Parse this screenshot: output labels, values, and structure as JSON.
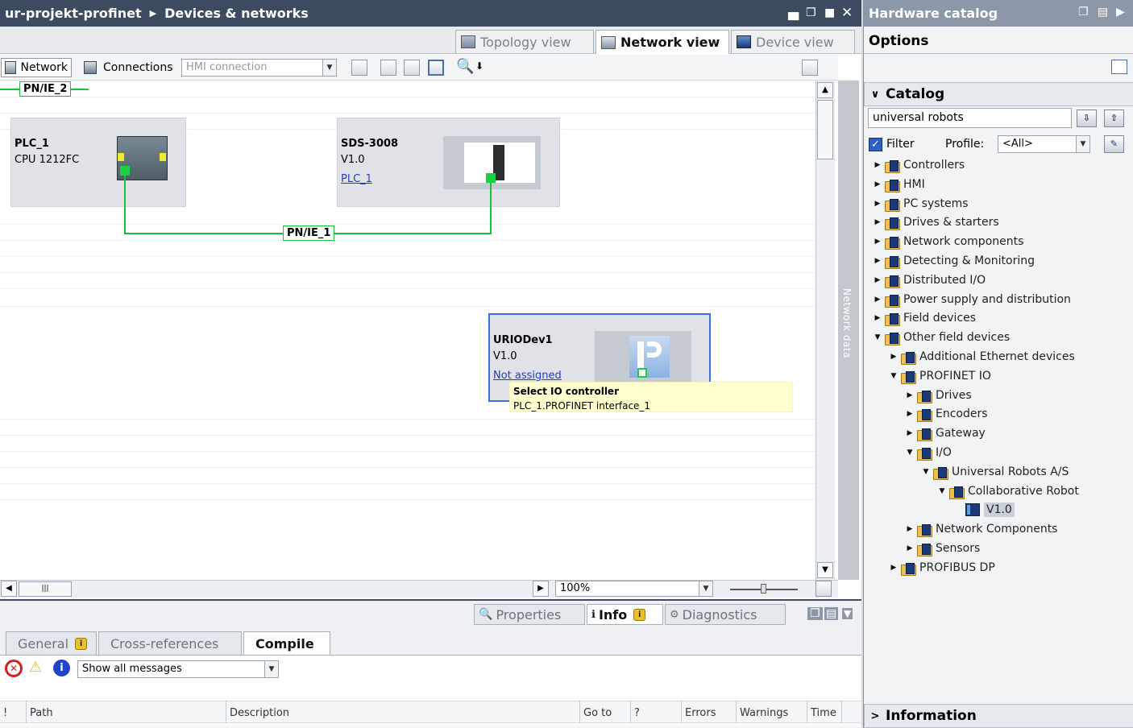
{
  "window": {
    "breadcrumb_project": "ur-projekt-profinet",
    "breadcrumb_page": "Devices & networks"
  },
  "view_tabs": [
    {
      "label": "Topology view"
    },
    {
      "label": "Network view"
    },
    {
      "label": "Device view"
    }
  ],
  "toolbar": {
    "network_label": "Network",
    "connections_label": "Connections",
    "connection_type": "HMI connection"
  },
  "canvas": {
    "subnet_top": "PN/IE_2",
    "subnet_main": "PN/IE_1",
    "devices": [
      {
        "name": "PLC_1",
        "sub": "CPU 1212FC",
        "link": ""
      },
      {
        "name": "SDS-3008",
        "sub": "V1.0",
        "link": "PLC_1"
      },
      {
        "name": "URIODev1",
        "sub": "V1.0",
        "link": "Not assigned"
      }
    ],
    "tooltip_title": "Select IO controller",
    "tooltip_value": "PLC_1.PROFINET interface_1",
    "zoom": "100%",
    "side_panel": "Network data"
  },
  "inspector": {
    "tabs": [
      {
        "label": "Properties"
      },
      {
        "label": "Info"
      },
      {
        "label": "Diagnostics"
      }
    ],
    "subtabs": [
      {
        "label": "General"
      },
      {
        "label": "Cross-references"
      },
      {
        "label": "Compile"
      }
    ],
    "filter": "Show all messages",
    "columns": [
      "!",
      "Path",
      "Description",
      "Go to",
      "?",
      "Errors",
      "Warnings",
      "Time"
    ]
  },
  "catalog": {
    "title": "Hardware catalog",
    "options_label": "Options",
    "catalog_label": "Catalog",
    "search_value": "universal robots",
    "filter_label": "Filter",
    "profile_label": "Profile:",
    "profile_value": "<All>",
    "information_label": "Information",
    "tree": [
      {
        "label": "Controllers",
        "level": 0,
        "state": "collapsed"
      },
      {
        "label": "HMI",
        "level": 0,
        "state": "collapsed"
      },
      {
        "label": "PC systems",
        "level": 0,
        "state": "collapsed"
      },
      {
        "label": "Drives & starters",
        "level": 0,
        "state": "collapsed"
      },
      {
        "label": "Network components",
        "level": 0,
        "state": "collapsed"
      },
      {
        "label": "Detecting & Monitoring",
        "level": 0,
        "state": "collapsed"
      },
      {
        "label": "Distributed I/O",
        "level": 0,
        "state": "collapsed"
      },
      {
        "label": "Power supply and distribution",
        "level": 0,
        "state": "collapsed"
      },
      {
        "label": "Field devices",
        "level": 0,
        "state": "collapsed"
      },
      {
        "label": "Other field devices",
        "level": 0,
        "state": "expanded"
      },
      {
        "label": "Additional Ethernet devices",
        "level": 1,
        "state": "collapsed"
      },
      {
        "label": "PROFINET IO",
        "level": 1,
        "state": "expanded"
      },
      {
        "label": "Drives",
        "level": 2,
        "state": "collapsed"
      },
      {
        "label": "Encoders",
        "level": 2,
        "state": "collapsed"
      },
      {
        "label": "Gateway",
        "level": 2,
        "state": "collapsed"
      },
      {
        "label": "I/O",
        "level": 2,
        "state": "expanded"
      },
      {
        "label": "Universal Robots A/S",
        "level": 3,
        "state": "expanded"
      },
      {
        "label": "Collaborative Robot",
        "level": 4,
        "state": "expanded"
      },
      {
        "label": "V1.0",
        "level": 5,
        "state": "leaf"
      },
      {
        "label": "Network Components",
        "level": 2,
        "state": "collapsed"
      },
      {
        "label": "Sensors",
        "level": 2,
        "state": "collapsed"
      },
      {
        "label": "PROFIBUS DP",
        "level": 1,
        "state": "collapsed"
      }
    ]
  }
}
